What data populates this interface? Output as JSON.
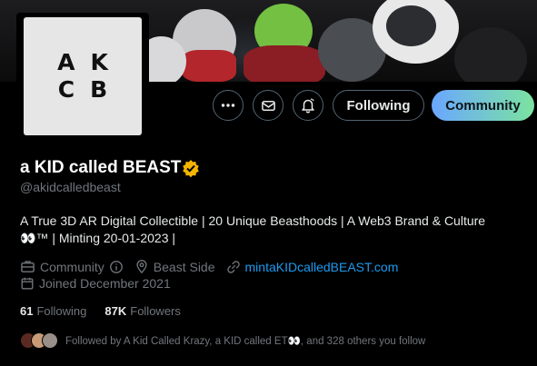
{
  "logo": {
    "line1": "AK",
    "line2": "CB"
  },
  "profile": {
    "display_name": "a KID called BEAST",
    "verified_color": "#f4b400",
    "handle": "@akidcalledbeast",
    "bio_line1": "A True 3D AR Digital Collectible | 20 Unique Beasthoods | A Web3 Brand & Culture",
    "bio_line2": "👀™ | Minting 20-01-2023 |",
    "category": "Community",
    "location": "Beast Side",
    "website": "mintaKIDcalledBEAST.com",
    "joined": "Joined December 2021",
    "following_count": "61",
    "following_label": "Following",
    "followers_count": "87K",
    "followers_label": "Followers",
    "followed_by": "Followed by A Kid Called Krazy, a KID called ET👀, and 328 others you follow"
  },
  "actions": {
    "more_icon": "more-icon",
    "message_icon": "envelope-icon",
    "notify_icon": "bell-icon",
    "following_label": "Following",
    "community_label": "Community"
  },
  "colors": {
    "background": "#000000",
    "link": "#1d9bf0",
    "muted": "#71767b",
    "border": "#536471"
  }
}
